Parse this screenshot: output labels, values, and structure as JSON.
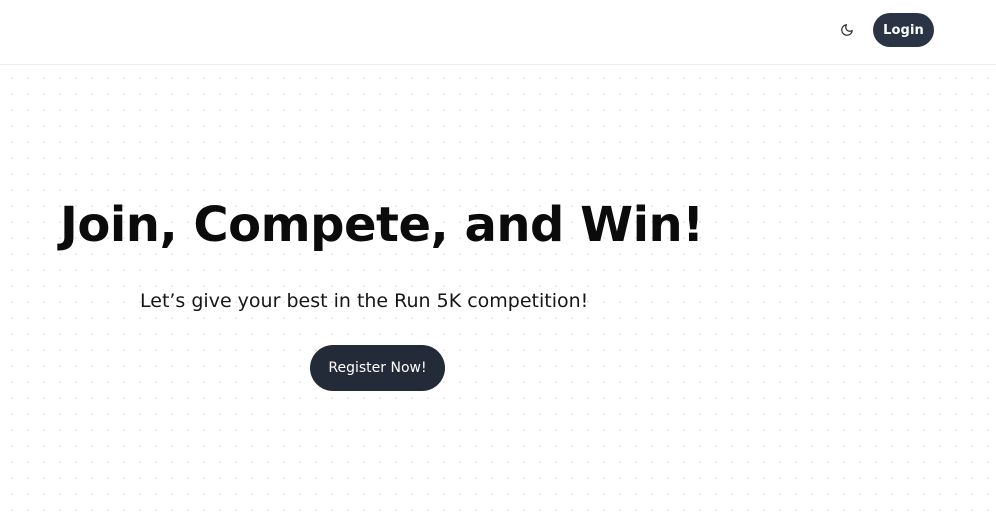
{
  "header": {
    "theme_toggle_icon": "moon-icon",
    "login_label": "Login"
  },
  "hero": {
    "title": "Join, Compete, and Win!",
    "subtitle": "Let’s give your best in the Run 5K competition!",
    "register_label": "Register Now!"
  },
  "colors": {
    "primary_button": "#232a38",
    "login_button": "#2b3444",
    "text": "#0b0b0b",
    "background": "#ffffff"
  }
}
